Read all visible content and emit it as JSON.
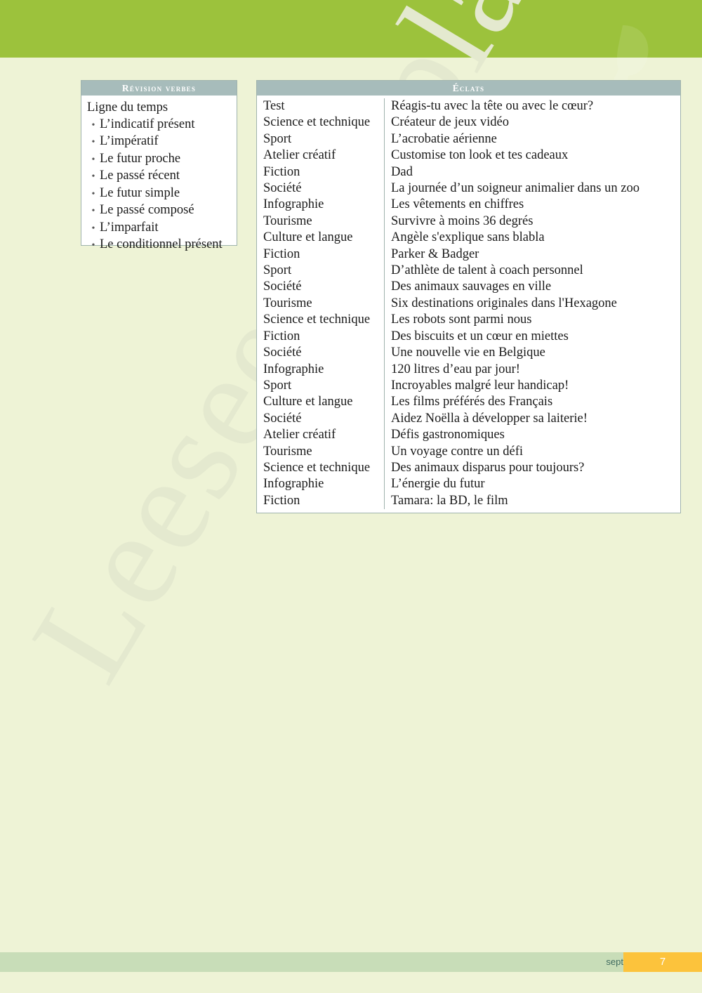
{
  "page": {
    "background_color": "#eef3d6",
    "top_band_color": "#9cc23c",
    "watermark_text": "Leeseexemplaar"
  },
  "verbs_table": {
    "header": "Révision verbes",
    "lead": "Ligne du temps",
    "items": [
      "L’indicatif présent",
      "L’impératif",
      "Le futur proche",
      "Le passé récent",
      "Le futur simple",
      "Le passé composé",
      "L’imparfait",
      "Le conditionnel présent"
    ],
    "bullet_glyph": "•"
  },
  "eclats_table": {
    "header": "Éclats",
    "rows": [
      {
        "category": "Test",
        "title": "Réagis-tu avec la tête ou avec le cœur?"
      },
      {
        "category": "Science et technique",
        "title": "Créateur de jeux vidéo"
      },
      {
        "category": "Sport",
        "title": "L’acrobatie aérienne"
      },
      {
        "category": "Atelier créatif",
        "title": "Customise ton look et tes cadeaux"
      },
      {
        "category": "Fiction",
        "title": "Dad"
      },
      {
        "category": "Société",
        "title": "La journée d’un soigneur animalier dans un zoo"
      },
      {
        "category": "Infographie",
        "title": "Les vêtements en chiffres"
      },
      {
        "category": "Tourisme",
        "title": "Survivre à moins 36 degrés"
      },
      {
        "category": "Culture et langue",
        "title": "Angèle s'explique sans blabla"
      },
      {
        "category": "Fiction",
        "title": "Parker & Badger"
      },
      {
        "category": "Sport",
        "title": "D’athlète de talent à coach personnel"
      },
      {
        "category": "Société",
        "title": "Des animaux sauvages en ville"
      },
      {
        "category": "Tourisme",
        "title": "Six destinations originales dans l'Hexagone"
      },
      {
        "category": "Science et technique",
        "title": "Les robots sont parmi nous"
      },
      {
        "category": "Fiction",
        "title": "Des biscuits et un cœur en miettes"
      },
      {
        "category": "Société",
        "title": "Une nouvelle vie en Belgique"
      },
      {
        "category": "Infographie",
        "title": "120 litres d’eau par jour!"
      },
      {
        "category": "Sport",
        "title": "Incroyables malgré leur handicap!"
      },
      {
        "category": "Culture et langue",
        "title": "Les films préférés des Français"
      },
      {
        "category": "Société",
        "title": "Aidez Noëlla à développer sa laiterie!"
      },
      {
        "category": "Atelier créatif",
        "title": "Défis gastronomiques"
      },
      {
        "category": "Tourisme",
        "title": "Un voyage contre un défi"
      },
      {
        "category": "Science et technique",
        "title": "Des animaux disparus pour toujours?"
      },
      {
        "category": "Infographie",
        "title": "L’énergie du futur"
      },
      {
        "category": "Fiction",
        "title": "Tamara: la BD, le film"
      }
    ]
  },
  "footer": {
    "page_word": "sept",
    "page_number": "7",
    "bar_color": "#c8ddb8",
    "page_number_color": "#fcc33c"
  }
}
